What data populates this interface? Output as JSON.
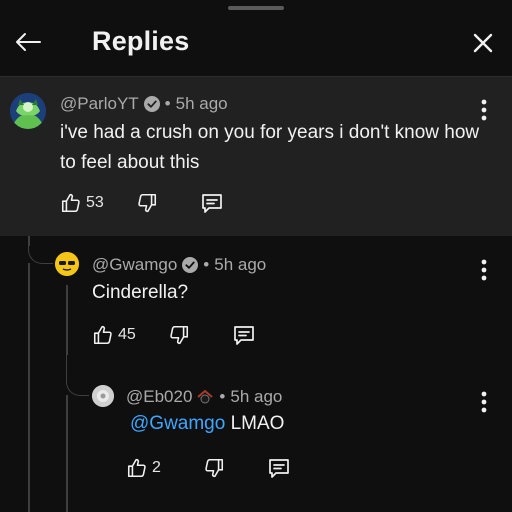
{
  "header": {
    "title": "Replies"
  },
  "top_comment": {
    "handle": "@ParloYT",
    "time": "5h ago",
    "text": "i've had a crush on you for years i don't know how to feel about this",
    "likes": "53"
  },
  "reply1": {
    "handle": "@Gwamgo",
    "time": "5h ago",
    "text": "Cinderella?",
    "likes": "45"
  },
  "reply2": {
    "handle": "@Eb020",
    "time": "5h ago",
    "mention": "@Gwamgo",
    "text": " LMAO",
    "likes": "2"
  },
  "separator": "•",
  "icons": {
    "back": "back-arrow-icon",
    "close": "close-icon",
    "like": "thumbs-up-icon",
    "dislike": "thumbs-down-icon",
    "reply": "reply-icon",
    "more": "more-vert-icon",
    "verified": "verified-check-icon"
  },
  "colors": {
    "background": "#0f0f0f",
    "highlight": "#212121",
    "mention": "#3ea6ff",
    "secondary_text": "#aaaaaa"
  }
}
